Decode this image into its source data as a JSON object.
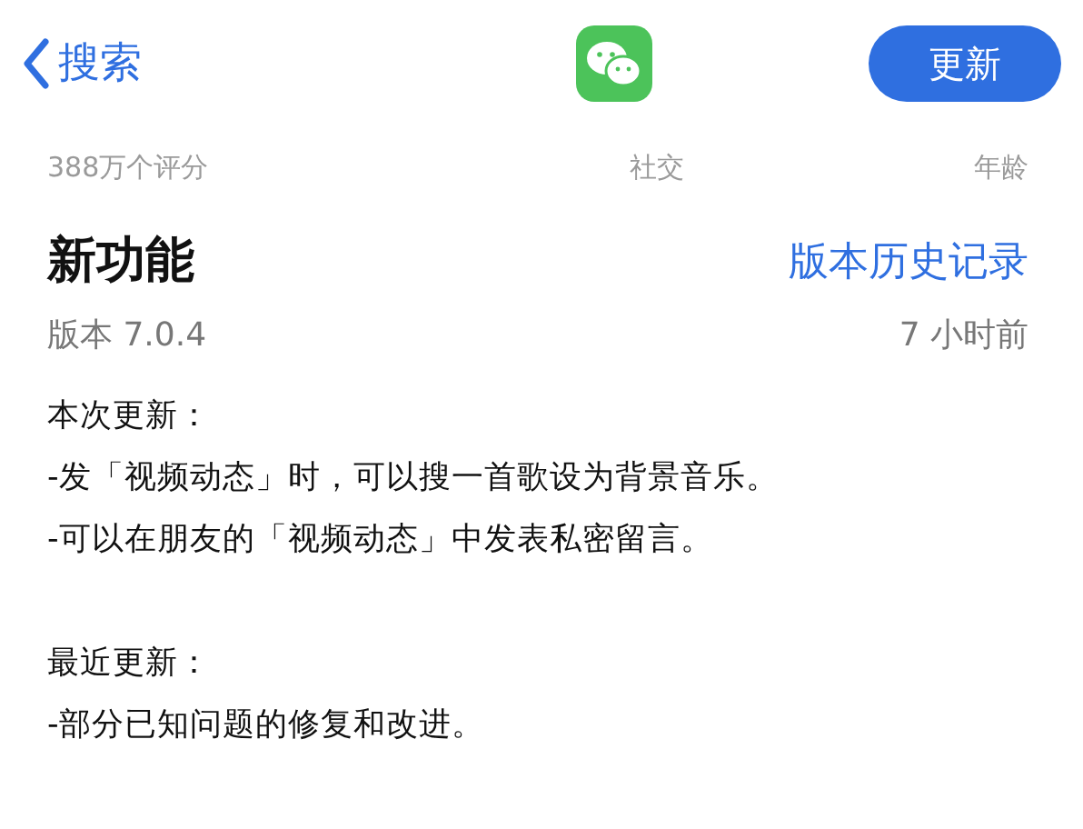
{
  "nav": {
    "back_label": "搜索",
    "action_button": "更新"
  },
  "stats": [
    "388万个评分",
    "社交",
    "年龄"
  ],
  "whats_new": {
    "title": "新功能",
    "history_link": "版本历史记录",
    "version": "版本 7.0.4",
    "time": "7 小时前",
    "sections": [
      {
        "heading": "本次更新：",
        "lines": [
          "-发「视频动态」时，可以搜一首歌设为背景音乐。",
          "-可以在朋友的「视频动态」中发表私密留言。"
        ]
      },
      {
        "heading": "最近更新：",
        "lines": [
          "-部分已知问题的修复和改进。"
        ]
      }
    ]
  }
}
